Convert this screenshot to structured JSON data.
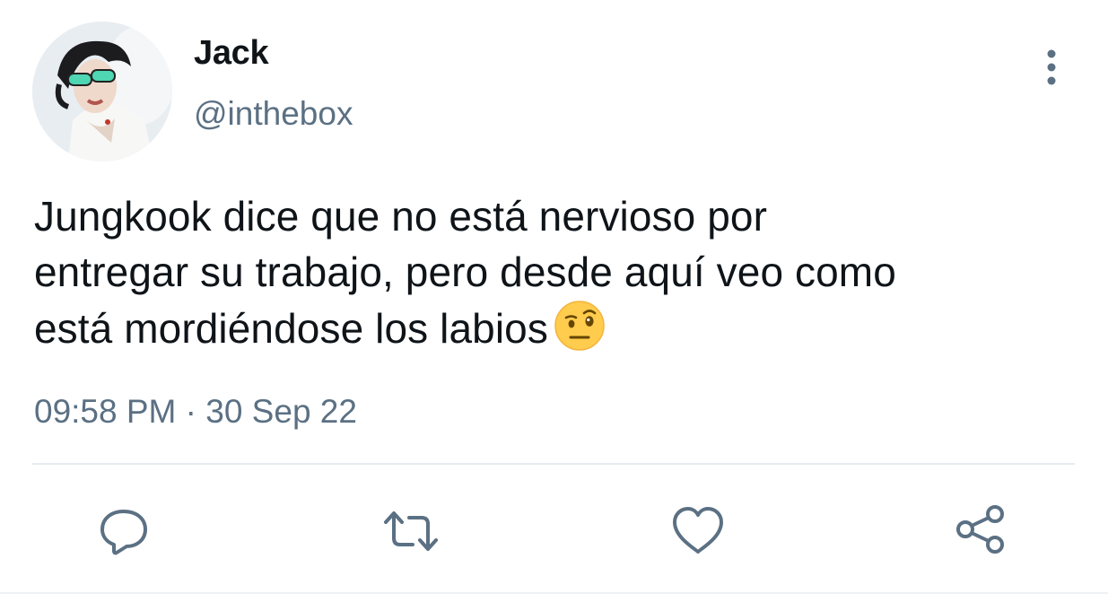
{
  "user": {
    "display_name": "Jack",
    "handle": "@inthebox"
  },
  "tweet": {
    "text_lines": [
      "Jungkook dice que no está nervioso por",
      "entregar su trabajo, pero desde aquí veo como",
      "está mordiéndose los labios"
    ],
    "emoji": "face-with-raised-eyebrow",
    "timestamp": "09:58 PM · 30 Sep 22"
  },
  "actions": [
    {
      "name": "reply",
      "icon": "comment-icon"
    },
    {
      "name": "retweet",
      "icon": "retweet-icon"
    },
    {
      "name": "like",
      "icon": "heart-icon"
    },
    {
      "name": "share",
      "icon": "share-icon"
    }
  ],
  "colors": {
    "text_primary": "#0f1419",
    "text_secondary": "#5b7083",
    "icon": "#5b7083",
    "divider": "#e6ecf0"
  }
}
